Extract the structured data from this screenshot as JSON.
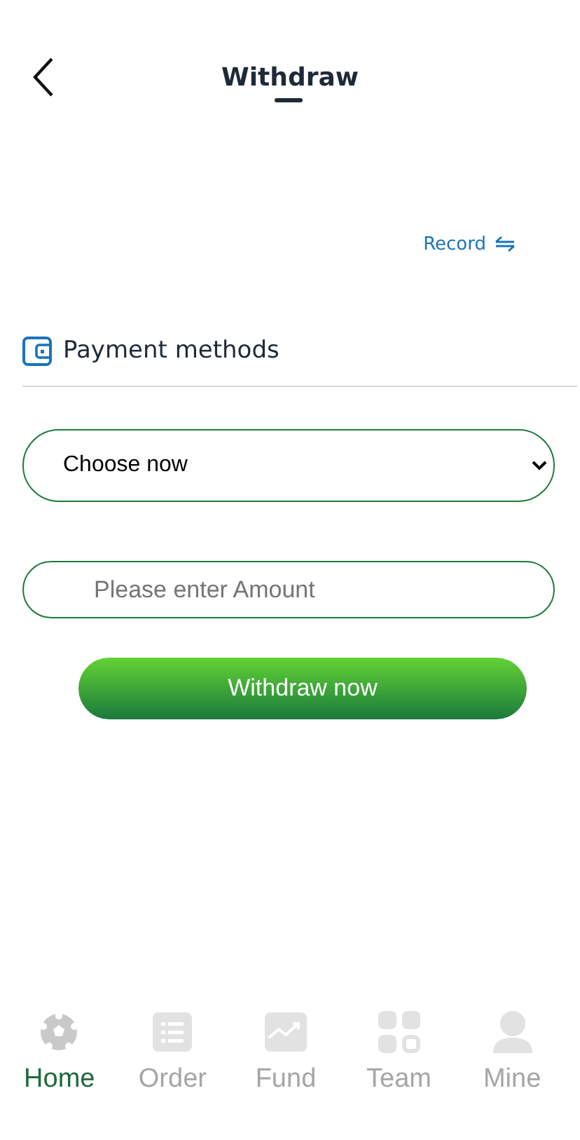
{
  "header": {
    "title": "Withdraw"
  },
  "record_link": {
    "label": "Record"
  },
  "section": {
    "title": "Payment methods"
  },
  "form": {
    "method_select": {
      "value": "Choose now"
    },
    "amount_field": {
      "placeholder": "Please enter Amount"
    },
    "submit": {
      "label": "Withdraw now"
    }
  },
  "tab_bar": [
    {
      "label": "Home",
      "selected": true
    },
    {
      "label": "Order",
      "selected": false
    },
    {
      "label": "Fund",
      "selected": false
    },
    {
      "label": "Team",
      "selected": false
    },
    {
      "label": "Mine",
      "selected": false
    }
  ]
}
